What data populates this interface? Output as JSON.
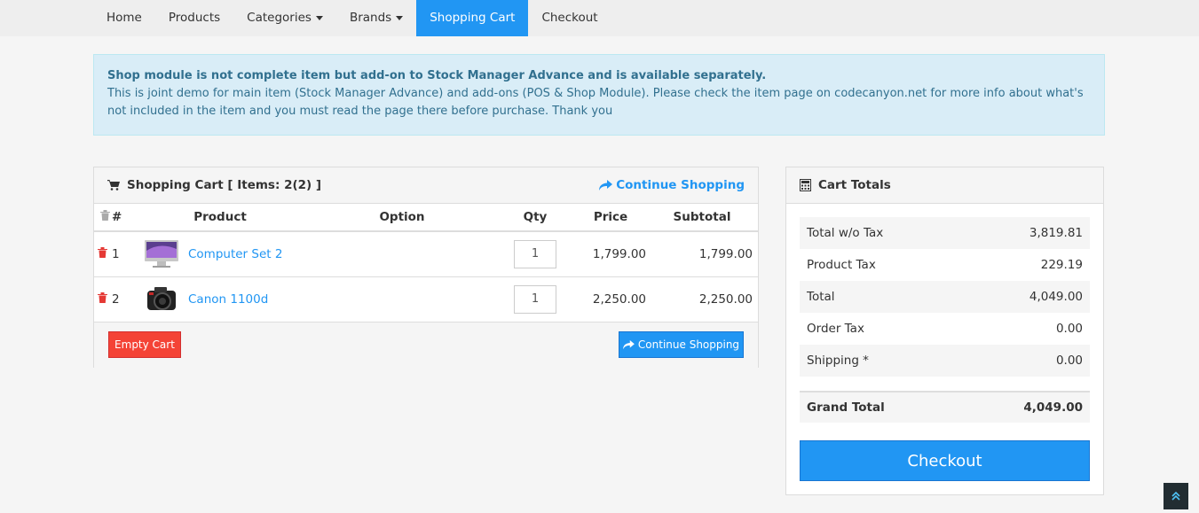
{
  "nav": {
    "items": [
      {
        "label": "Home",
        "dropdown": false,
        "active": false
      },
      {
        "label": "Products",
        "dropdown": false,
        "active": false
      },
      {
        "label": "Categories",
        "dropdown": true,
        "active": false
      },
      {
        "label": "Brands",
        "dropdown": true,
        "active": false
      },
      {
        "label": "Shopping Cart",
        "dropdown": false,
        "active": true
      },
      {
        "label": "Checkout",
        "dropdown": false,
        "active": false
      }
    ]
  },
  "alert": {
    "title": "Shop module is not complete item but add-on to Stock Manager Advance and is available separately.",
    "body": "This is joint demo for main item (Stock Manager Advance) and add-ons (POS & Shop Module). Please check the item page on codecanyon.net for more info about what's not included in the item and you must read the page there before purchase. Thank you"
  },
  "cart": {
    "heading": "Shopping Cart [ Items: 2(2) ]",
    "continue_link": "Continue Shopping",
    "columns": {
      "number": "#",
      "product": "Product",
      "option": "Option",
      "qty": "Qty",
      "price": "Price",
      "subtotal": "Subtotal"
    },
    "rows": [
      {
        "index": "1",
        "name": "Computer Set 2",
        "image": "imac-icon",
        "option": "",
        "qty": "1",
        "price": "1,799.00",
        "subtotal": "1,799.00"
      },
      {
        "index": "2",
        "name": "Canon 1100d",
        "image": "camera-icon",
        "option": "",
        "qty": "1",
        "price": "2,250.00",
        "subtotal": "2,250.00"
      }
    ],
    "empty_button": "Empty Cart",
    "continue_button": "Continue Shopping"
  },
  "totals": {
    "heading": "Cart Totals",
    "rows": [
      {
        "label": "Total w/o Tax",
        "value": "3,819.81"
      },
      {
        "label": "Product Tax",
        "value": "229.19"
      },
      {
        "label": "Total",
        "value": "4,049.00"
      },
      {
        "label": "Order Tax",
        "value": "0.00"
      },
      {
        "label": "Shipping *",
        "value": "0.00"
      }
    ],
    "grand_label": "Grand Total",
    "grand_value": "4,049.00",
    "checkout_button": "Checkout"
  },
  "colors": {
    "accent": "#2196f3",
    "danger": "#f44336",
    "info_bg": "#d9edf7",
    "info_text": "#31708f"
  }
}
